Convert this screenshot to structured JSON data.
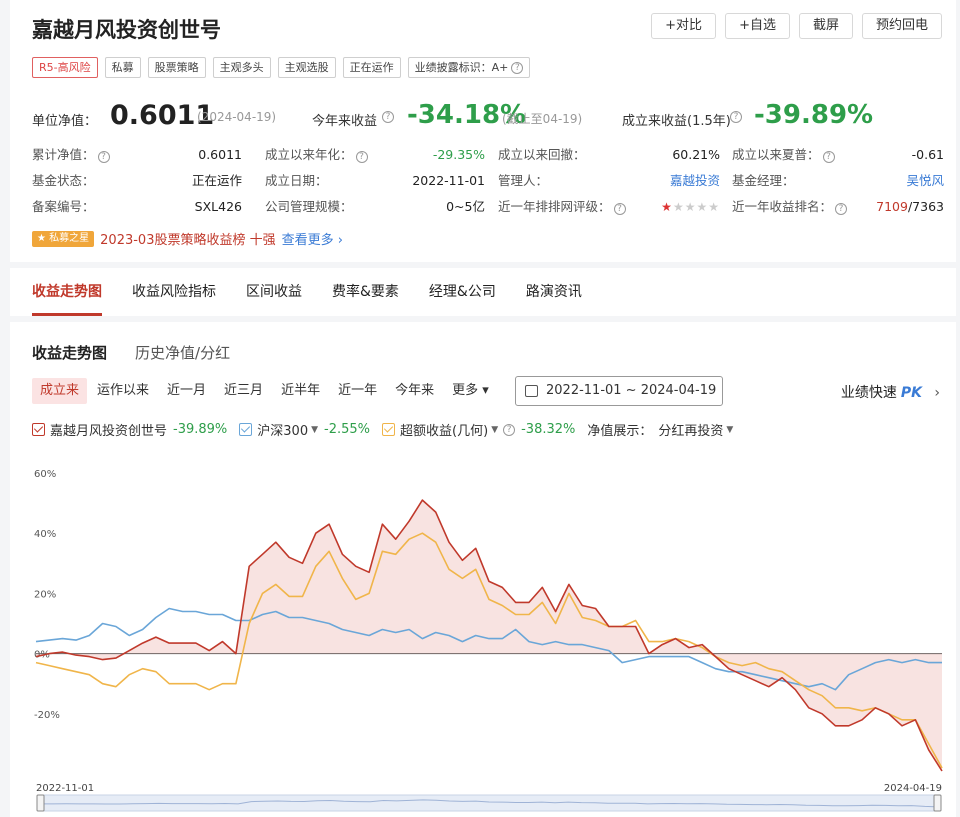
{
  "fund": {
    "title": "嘉越月风投资创世号",
    "actions": [
      "+对比",
      "+自选",
      "截屏",
      "预约回电"
    ],
    "tags": [
      "R5-高风险",
      "私募",
      "股票策略",
      "主观多头",
      "主观选股",
      "正在运作",
      "业绩披露标识：A+"
    ],
    "nav_label": "单位净值：",
    "nav_value": "0.6011",
    "nav_date": "(2024-04-19)",
    "ytd_label": "今年来收益",
    "ytd_value": "-34.18%",
    "ytd_note": "(截止至04-19)",
    "since_label": "成立来收益(1.5年)",
    "since_value": "-39.89%"
  },
  "info_rows": [
    [
      {
        "k": "累计净值：",
        "v": "0.6011",
        "q": true
      },
      {
        "k": "成立以来年化：",
        "v": "-29.35%",
        "q": true,
        "c": "green"
      },
      {
        "k": "成立以来回撤：",
        "v": "60.21%"
      },
      {
        "k": "成立以来夏普：",
        "v": "-0.61",
        "q": true
      }
    ],
    [
      {
        "k": "基金状态：",
        "v": "正在运作"
      },
      {
        "k": "成立日期：",
        "v": "2022-11-01"
      },
      {
        "k": "管理人：",
        "v": "嘉越投资",
        "c": "blue"
      },
      {
        "k": "基金经理：",
        "v": "吴悦风",
        "c": "blue"
      }
    ],
    [
      {
        "k": "备案编号：",
        "v": "SXL426"
      },
      {
        "k": "公司管理规模：",
        "v": "0~5亿"
      },
      {
        "k": "近一年排排网评级：",
        "v": "",
        "q": true,
        "stars": 1
      },
      {
        "k": "近一年收益排名：",
        "v": "7109",
        "v2": "/7363",
        "q": true,
        "c": "red"
      }
    ]
  ],
  "honor": {
    "badge": "★ 私募之星",
    "text": "2023-03股票策略收益榜 十强",
    "more": "查看更多 ›"
  },
  "tabs": [
    "收益走势图",
    "收益风险指标",
    "区间收益",
    "费率&要素",
    "经理&公司",
    "路演资讯"
  ],
  "subtabs": [
    "收益走势图",
    "历史净值/分红"
  ],
  "periods": [
    "成立来",
    "运作以来",
    "近一月",
    "近三月",
    "近半年",
    "近一年",
    "今年来",
    "更多 ▾"
  ],
  "date_range": "2022-11-01 ~ 2024-04-19",
  "pk": {
    "label": "业绩快速",
    "bold": "PK",
    "arrow": "›"
  },
  "legend": [
    {
      "name": "嘉越月风投资创世号",
      "value": "-39.89%",
      "color": "#c0392b"
    },
    {
      "name": "沪深300",
      "value": "-2.55%",
      "color": "#6aa6d8",
      "dropdown": true
    },
    {
      "name": "超额收益(几何)",
      "value": "-38.32%",
      "color": "#f0b54a",
      "dropdown": true,
      "q": true
    }
  ],
  "display_label": "净值展示：",
  "display_value": "分红再投资",
  "chart_data": {
    "type": "line",
    "x_start": "2022-11-01",
    "x_end": "2024-04-19",
    "yticks": [
      60,
      40,
      20,
      0,
      -20
    ],
    "ylim": [
      -40,
      62
    ],
    "grid": false,
    "series": [
      {
        "name": "嘉越月风投资创世号",
        "color": "#c0392b",
        "fill": true,
        "values": [
          -1,
          0,
          0.5,
          -0.5,
          -1,
          -2,
          -1.5,
          1,
          3.5,
          5.5,
          3.5,
          3.5,
          3.5,
          1,
          4,
          0,
          29,
          33,
          37,
          32,
          30,
          40,
          43,
          33,
          29,
          27,
          43,
          38,
          44,
          51,
          47,
          37,
          31,
          35,
          24,
          22,
          17,
          17,
          22,
          14,
          23,
          16,
          15,
          9,
          9,
          9,
          0,
          3,
          5,
          2,
          3,
          -1,
          -5,
          -7,
          -9,
          -11,
          -8,
          -12,
          -18,
          -20,
          -24,
          -24,
          -22,
          -18,
          -20,
          -24,
          -22,
          -32,
          -39
        ]
      },
      {
        "name": "沪深300",
        "color": "#6aa6d8",
        "fill": false,
        "values": [
          4,
          4.5,
          5,
          4.5,
          6,
          10,
          9,
          6,
          8,
          12,
          15,
          14,
          14,
          13,
          13,
          11,
          11,
          13,
          14,
          12,
          12,
          11,
          10,
          8,
          7,
          6,
          8,
          7,
          8,
          5,
          7,
          6,
          4,
          6,
          5,
          5,
          8,
          4,
          3,
          4,
          3,
          3,
          2,
          1,
          -3,
          -2,
          -1,
          -1,
          -1,
          -1,
          -3,
          -5,
          -6,
          -6,
          -7,
          -8,
          -9,
          -10,
          -11,
          -10,
          -12,
          -7,
          -5,
          -3,
          -2,
          -3,
          -2,
          -3,
          -3
        ]
      },
      {
        "name": "超额收益(几何)",
        "color": "#f0b54a",
        "fill": false,
        "values": [
          -3,
          -4,
          -5,
          -6,
          -7,
          -10,
          -11,
          -7,
          -5,
          -6,
          -10,
          -10,
          -10,
          -12,
          -10,
          -10,
          10,
          20,
          23,
          19,
          19,
          29,
          34,
          25,
          18,
          20,
          34,
          33,
          38,
          40,
          37,
          28,
          25,
          28,
          18,
          16,
          13,
          13,
          17,
          10,
          20,
          12,
          11,
          9,
          9,
          11,
          4,
          4,
          5,
          4,
          2,
          -1,
          -3,
          -4,
          -3,
          -5,
          -6,
          -9,
          -12,
          -14,
          -18,
          -18,
          -19,
          -18,
          -20,
          -22,
          -22,
          -30,
          -38
        ]
      }
    ]
  }
}
